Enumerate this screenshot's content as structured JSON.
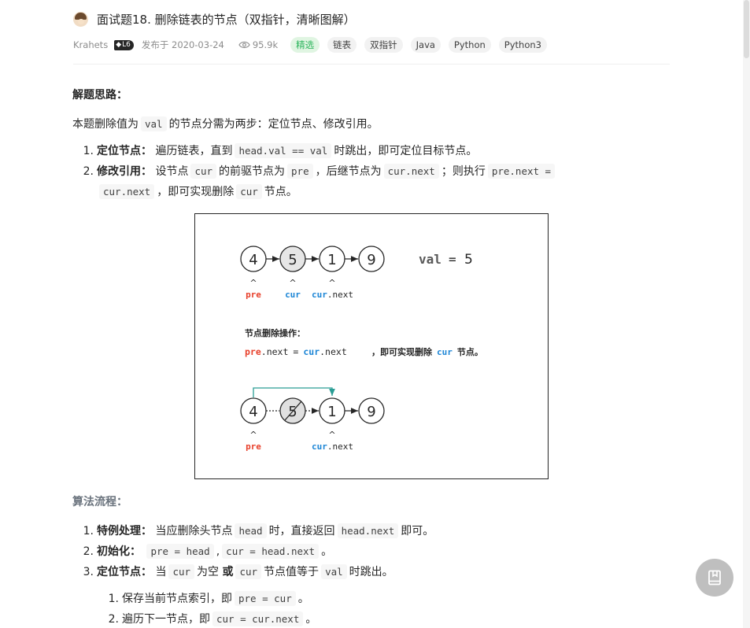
{
  "header": {
    "title": "面试题18. 删除链表的节点（双指针，清晰图解）",
    "author": "Krahets",
    "level": "L6",
    "published": "发布于 2020-03-24",
    "views": "95.9k",
    "tags": [
      "精选",
      "链表",
      "双指针",
      "Java",
      "Python",
      "Python3"
    ]
  },
  "content": {
    "section1_title": "解题思路：",
    "intro_pre": "本题删除值为",
    "intro_code": "val",
    "intro_post": "的节点分需为两步：定位节点、修改引用。",
    "step1_num": "1.",
    "step1_label": "定位节点：",
    "step1_text": "遍历链表，直到",
    "step1_code": "head.val == val",
    "step1_post": "时跳出，即可定位目标节点。",
    "step2_num": "2.",
    "step2_label": "修改引用：",
    "step2_text1": "设节点",
    "step2_code1": "cur",
    "step2_text2": "的前驱节点为",
    "step2_code2": "pre",
    "step2_text3": "，后继节点为",
    "step2_code3": "cur.next",
    "step2_text4": "；则执行",
    "step2_code4": "pre.next =",
    "step2_code5": "cur.next",
    "step2_text5": "，即可实现删除",
    "step2_code6": "cur",
    "step2_text6": "节点。",
    "section2_title": "算法流程：",
    "alg1_num": "1.",
    "alg1_label": "特例处理：",
    "alg1_text": "当应删除头节点",
    "alg1_code1": "head",
    "alg1_text2": "时，直接返回",
    "alg1_code2": "head.next",
    "alg1_text3": "即可。",
    "alg2_num": "2.",
    "alg2_label": "初始化：",
    "alg2_code1": "pre = head",
    "alg2_sep": ",",
    "alg2_code2": "cur = head.next",
    "alg2_end": "。",
    "alg3_num": "3.",
    "alg3_label": "定位节点：",
    "alg3_text1": "当",
    "alg3_code1": "cur",
    "alg3_text2": "为空",
    "alg3_or": "或",
    "alg3_code2": "cur",
    "alg3_text3": "节点值等于",
    "alg3_code3": "val",
    "alg3_text4": "时跳出。",
    "sub1_num": "1.",
    "sub1_text": "保存当前节点索引，即",
    "sub1_code": "pre = cur",
    "sub1_end": "。",
    "sub2_num": "2.",
    "sub2_text": "遍历下一节点，即",
    "sub2_code": "cur = cur.next",
    "sub2_end": "。"
  },
  "figure": {
    "nodes_top": [
      "4",
      "5",
      "1",
      "9"
    ],
    "nodes_bottom": [
      "4",
      "5",
      "1",
      "9"
    ],
    "val_label": "val",
    "val_eq": "=",
    "val_value": "5",
    "caret": "^",
    "ptr_pre": "pre",
    "ptr_cur": "cur",
    "ptr_next": ".next",
    "op_title": "节点删除操作：",
    "op_pre": "pre",
    "op_next1": ".next",
    "op_eq": "=",
    "op_cur": "cur",
    "op_next2": ".next",
    "op_text": "，即可实现删除",
    "op_cur2": "cur",
    "op_end": "节点。",
    "colors": {
      "pre": "#e8412c",
      "cur": "#1d86d6",
      "link": "#2a9d95"
    }
  },
  "fab": {
    "icon": "bookmark-book-icon"
  }
}
